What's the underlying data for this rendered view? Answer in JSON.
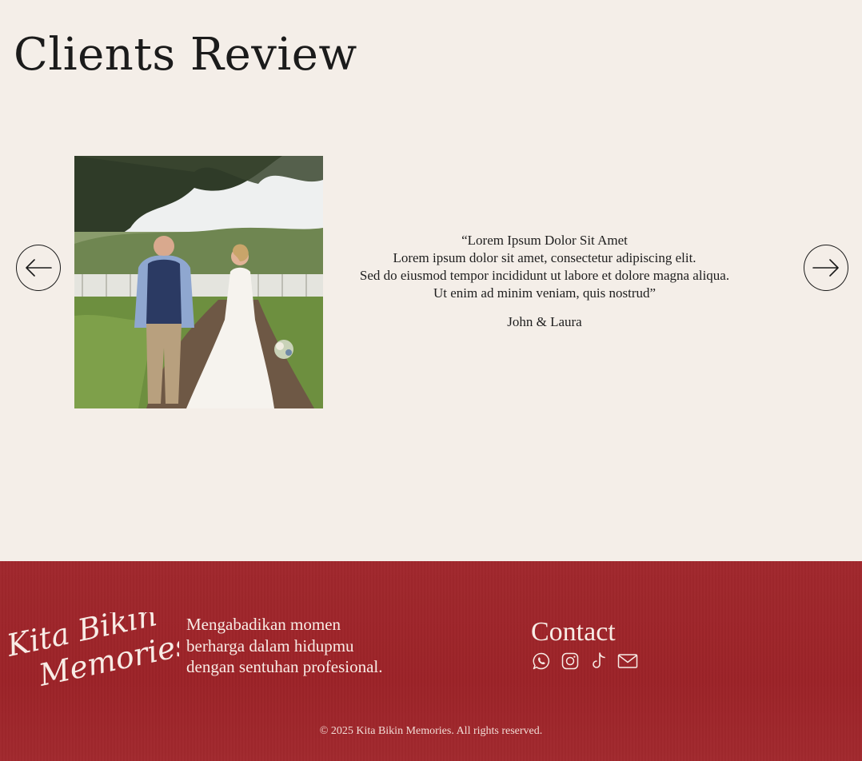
{
  "reviews": {
    "title": "Clients Review",
    "testimonial": {
      "lines": [
        "“Lorem Ipsum Dolor Sit Amet",
        "Lorem ipsum dolor sit amet, consectetur adipiscing elit.",
        "Sed do eiusmod tempor incididunt ut labore et dolore magna aliqua.",
        "Ut enim ad minim veniam, quis nostrud”"
      ],
      "author": "John & Laura"
    },
    "nav": {
      "prev_icon": "arrow-left-icon",
      "next_icon": "arrow-right-icon"
    }
  },
  "footer": {
    "logo": {
      "line1": "Kita Bikin",
      "line2": "Memories"
    },
    "tagline": [
      "Mengabadikan momen",
      "berharga dalam hidupmu",
      "dengan sentuhan profesional."
    ],
    "contact_title": "Contact",
    "contact_icons": [
      "whatsapp-icon",
      "instagram-icon",
      "tiktok-icon",
      "email-icon"
    ],
    "copyright": "© 2025 Kita Bikin Memories. All rights reserved."
  },
  "colors": {
    "background": "#f4eee8",
    "footer": "#a1282d",
    "footer_text": "#f8ece6"
  }
}
